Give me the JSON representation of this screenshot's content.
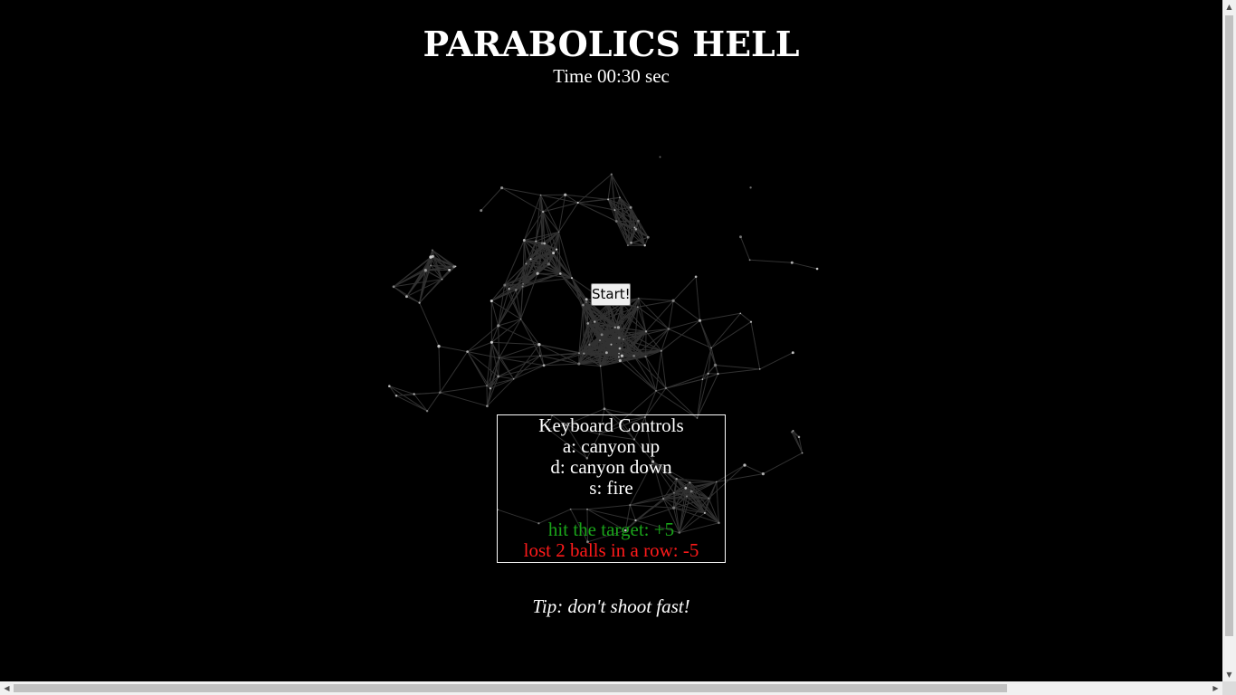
{
  "game": {
    "title": "PARABOLICS HELL",
    "timer": "Time 00:30 sec",
    "start_label": "Start!"
  },
  "controls": {
    "heading": "Keyboard Controls",
    "up": "a: canyon up",
    "down": "d: canyon down",
    "fire": "s: fire",
    "hit": "hit the target: +5",
    "lost": "lost 2 balls in a row: -5"
  },
  "tip": "Tip: don't shoot fast!",
  "colors": {
    "background": "#000000",
    "text": "#ffffff",
    "bonus": "#1aa31a",
    "penalty": "#ff1a1a"
  },
  "scrollbars": {
    "up_icon": "▲",
    "down_icon": "▼",
    "left_icon": "◀",
    "right_icon": "▶"
  }
}
